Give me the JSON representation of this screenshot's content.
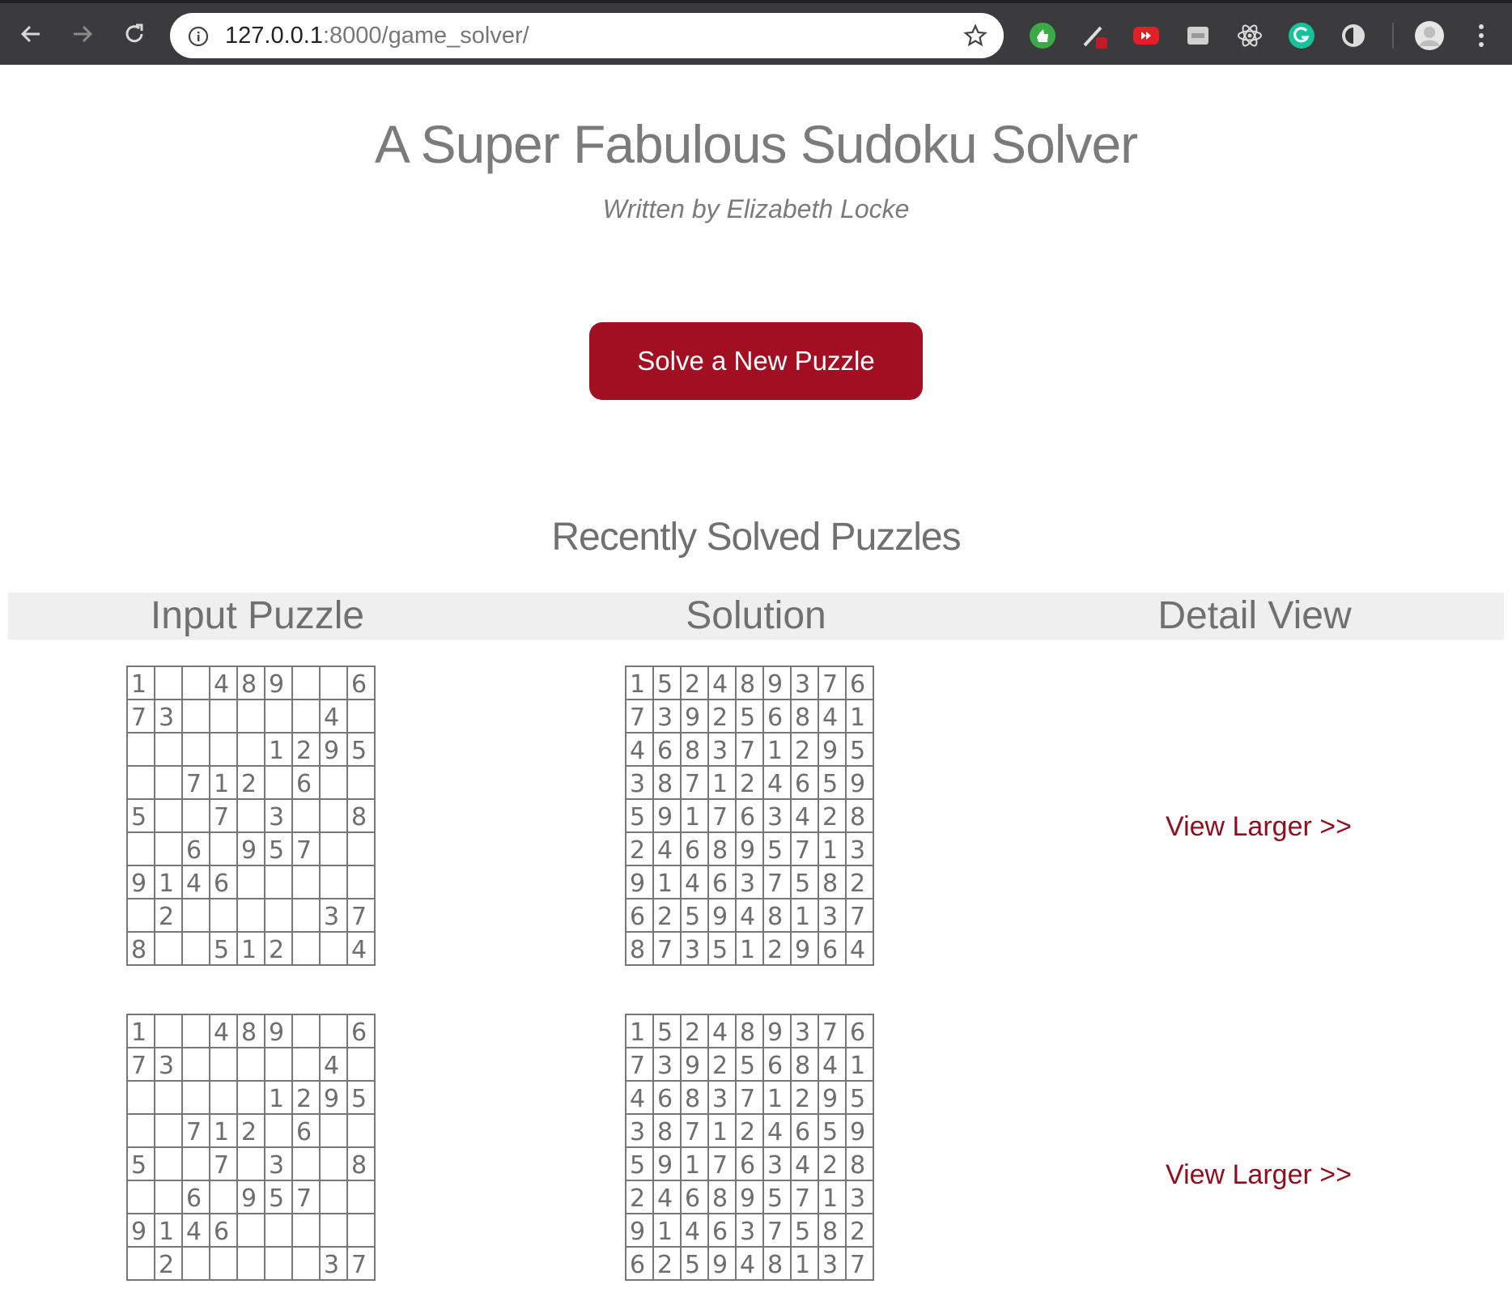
{
  "browser": {
    "url_host": "127.0.0.1",
    "url_rest": ":8000/game_solver/"
  },
  "header": {
    "title": "A Super Fabulous Sudoku Solver",
    "subtitle": "Written by Elizabeth Locke"
  },
  "solve_button": "Solve a New Puzzle",
  "recent": {
    "title": "Recently Solved Puzzles",
    "columns": [
      "Input Puzzle",
      "Solution",
      "Detail View"
    ],
    "link_label": "View Larger >>",
    "puzzles": [
      {
        "input": [
          [
            "1",
            "",
            "",
            "4",
            "8",
            "9",
            "",
            "",
            "6"
          ],
          [
            "7",
            "3",
            "",
            "",
            "",
            "",
            "",
            "4",
            ""
          ],
          [
            "",
            "",
            "",
            "",
            "",
            "1",
            "2",
            "9",
            "5"
          ],
          [
            "",
            "",
            "7",
            "1",
            "2",
            "",
            "6",
            "",
            ""
          ],
          [
            "5",
            "",
            "",
            "7",
            "",
            "3",
            "",
            "",
            "8"
          ],
          [
            "",
            "",
            "6",
            "",
            "9",
            "5",
            "7",
            "",
            ""
          ],
          [
            "9",
            "1",
            "4",
            "6",
            "",
            "",
            "",
            "",
            ""
          ],
          [
            "",
            "2",
            "",
            "",
            "",
            "",
            "",
            "3",
            "7"
          ],
          [
            "8",
            "",
            "",
            "5",
            "1",
            "2",
            "",
            "",
            "4"
          ]
        ],
        "solution": [
          [
            "1",
            "5",
            "2",
            "4",
            "8",
            "9",
            "3",
            "7",
            "6"
          ],
          [
            "7",
            "3",
            "9",
            "2",
            "5",
            "6",
            "8",
            "4",
            "1"
          ],
          [
            "4",
            "6",
            "8",
            "3",
            "7",
            "1",
            "2",
            "9",
            "5"
          ],
          [
            "3",
            "8",
            "7",
            "1",
            "2",
            "4",
            "6",
            "5",
            "9"
          ],
          [
            "5",
            "9",
            "1",
            "7",
            "6",
            "3",
            "4",
            "2",
            "8"
          ],
          [
            "2",
            "4",
            "6",
            "8",
            "9",
            "5",
            "7",
            "1",
            "3"
          ],
          [
            "9",
            "1",
            "4",
            "6",
            "3",
            "7",
            "5",
            "8",
            "2"
          ],
          [
            "6",
            "2",
            "5",
            "9",
            "4",
            "8",
            "1",
            "3",
            "7"
          ],
          [
            "8",
            "7",
            "3",
            "5",
            "1",
            "2",
            "9",
            "6",
            "4"
          ]
        ]
      },
      {
        "input": [
          [
            "1",
            "",
            "",
            "4",
            "8",
            "9",
            "",
            "",
            "6"
          ],
          [
            "7",
            "3",
            "",
            "",
            "",
            "",
            "",
            "4",
            ""
          ],
          [
            "",
            "",
            "",
            "",
            "",
            "1",
            "2",
            "9",
            "5"
          ],
          [
            "",
            "",
            "7",
            "1",
            "2",
            "",
            "6",
            "",
            ""
          ],
          [
            "5",
            "",
            "",
            "7",
            "",
            "3",
            "",
            "",
            "8"
          ],
          [
            "",
            "",
            "6",
            "",
            "9",
            "5",
            "7",
            "",
            ""
          ],
          [
            "9",
            "1",
            "4",
            "6",
            "",
            "",
            "",
            "",
            ""
          ],
          [
            "",
            "2",
            "",
            "",
            "",
            "",
            "",
            "3",
            "7"
          ]
        ],
        "solution": [
          [
            "1",
            "5",
            "2",
            "4",
            "8",
            "9",
            "3",
            "7",
            "6"
          ],
          [
            "7",
            "3",
            "9",
            "2",
            "5",
            "6",
            "8",
            "4",
            "1"
          ],
          [
            "4",
            "6",
            "8",
            "3",
            "7",
            "1",
            "2",
            "9",
            "5"
          ],
          [
            "3",
            "8",
            "7",
            "1",
            "2",
            "4",
            "6",
            "5",
            "9"
          ],
          [
            "5",
            "9",
            "1",
            "7",
            "6",
            "3",
            "4",
            "2",
            "8"
          ],
          [
            "2",
            "4",
            "6",
            "8",
            "9",
            "5",
            "7",
            "1",
            "3"
          ],
          [
            "9",
            "1",
            "4",
            "6",
            "3",
            "7",
            "5",
            "8",
            "2"
          ],
          [
            "6",
            "2",
            "5",
            "9",
            "4",
            "8",
            "1",
            "3",
            "7"
          ]
        ]
      }
    ]
  },
  "icons": {
    "back": "back-arrow-icon",
    "forward": "forward-arrow-icon",
    "reload": "reload-icon",
    "info": "info-icon",
    "star": "bookmark-star-icon"
  },
  "colors": {
    "accent": "#a30f22",
    "link": "#8e1020",
    "text": "#7b7b7b"
  }
}
